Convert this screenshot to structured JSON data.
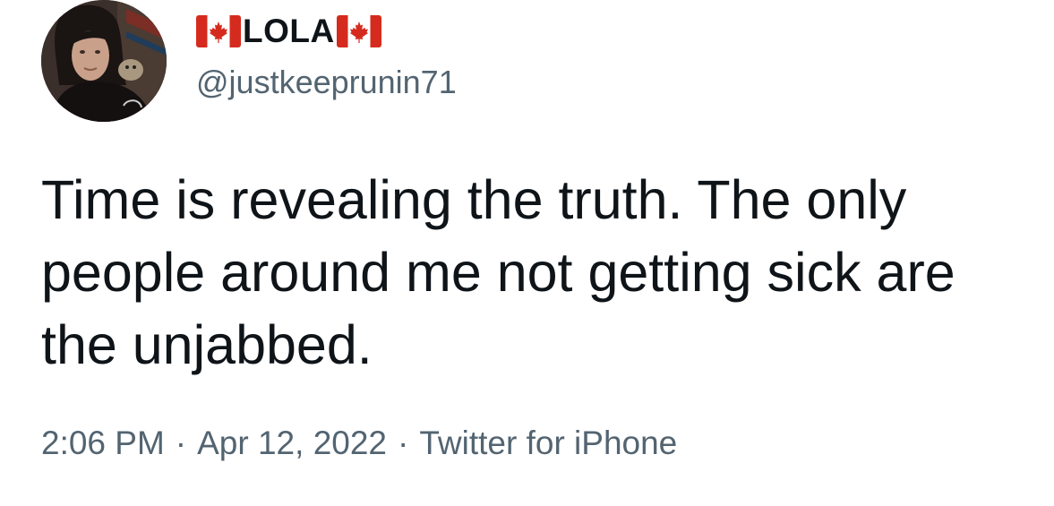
{
  "author": {
    "display_name": "LOLA",
    "handle": "@justkeeprunin71",
    "name_prefix_icon": "canada-flag-icon",
    "name_suffix_icon": "canada-flag-icon"
  },
  "tweet": {
    "text": "Time is revealing the truth. The only people around me not getting sick are the unjabbed."
  },
  "meta": {
    "time": "2:06 PM",
    "separator_1": "·",
    "date": "Apr 12, 2022",
    "separator_2": "·",
    "source": "Twitter for iPhone"
  },
  "colors": {
    "text_primary": "#0f1419",
    "text_secondary": "#536471",
    "flag_red": "#d52b1e",
    "background": "#ffffff"
  }
}
